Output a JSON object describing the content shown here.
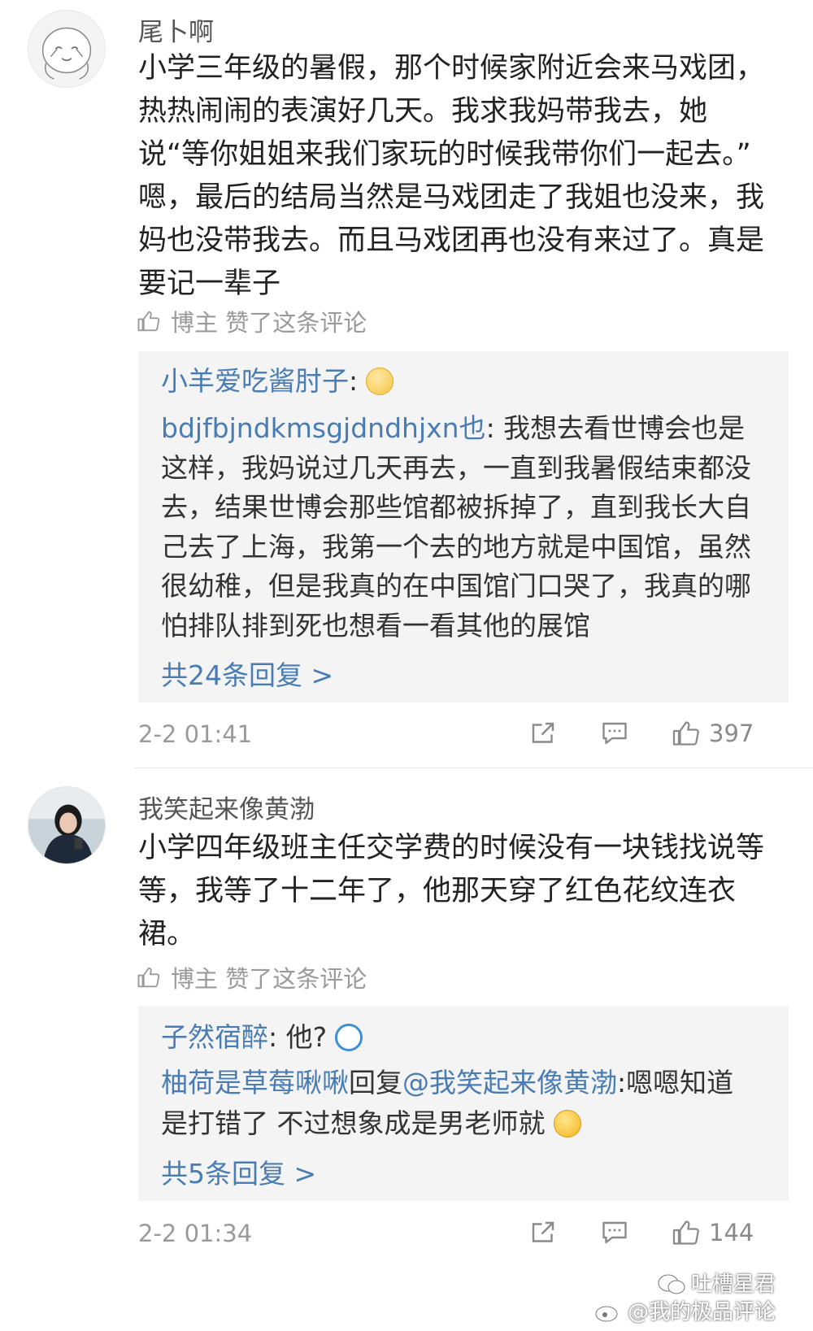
{
  "comments": [
    {
      "username": "尾卜啊",
      "text_lines": [
        "小学三年级的暑假，那个时候家附近会来马戏团，",
        "热热闹闹的表演好几天。我求我妈带我去，她",
        "说“等你姐姐来我们家玩的时候我带你们一起去。”",
        "嗯，最后的结局当然是马戏团走了我姐也没来，我",
        "妈也没带我去。而且马戏团再也没有来过了。真是",
        "要记一辈子"
      ],
      "liked_by_author": "博主 赞了这条评论",
      "replies": [
        {
          "name": "小羊爱吃酱肘子",
          "sep": ":",
          "lines": [
            ""
          ],
          "emoji": "flushed-emoji"
        },
        {
          "name": "bdjfbjndkmsgjdndhjxn也",
          "sep": ":",
          "lines": [
            " 我想去看世博会也是",
            "这样，我妈说过几天再去，一直到我暑假结束都没",
            "去，结果世博会那些馆都被拆掉了，直到我长大自",
            "己去了上海，我第一个去的地方就是中国馆，虽然",
            "很幼稚，但是我真的在中国馆门口哭了，我真的哪",
            "怕排队排到死也想看一看其他的展馆"
          ]
        }
      ],
      "more_replies": "共24条回复 >",
      "time": "2-2 01:41",
      "like_count": "397"
    },
    {
      "username": "我笑起来像黄渤",
      "text_lines": [
        "小学四年级班主任交学费的时候没有一块钱找说等",
        "等，我等了十二年了，他那天穿了红色花纹连衣",
        "裙。"
      ],
      "liked_by_author": "博主 赞了这条评论",
      "replies": [
        {
          "name": "子然宿醉",
          "sep": ":",
          "lines": [
            " 他?"
          ],
          "emoji": "robot-emoji"
        },
        {
          "name": "柚荷是草莓啾啾",
          "mid": "回复",
          "mention": "@我笑起来像黄渤",
          "sep": ":",
          "lines": [
            "嗯嗯知道",
            "是打错了 不过想象成是男老师就"
          ],
          "emoji": "laughing-emoji"
        }
      ],
      "more_replies": "共5条回复 >",
      "time": "2-2 01:34",
      "like_count": "144"
    }
  ],
  "watermark": {
    "line1": "吐槽星君",
    "line2": "@我的极品评论"
  },
  "colors": {
    "link": "#4a7cb4",
    "muted": "#9a9a9a",
    "reply_bg": "#f4f4f4"
  }
}
